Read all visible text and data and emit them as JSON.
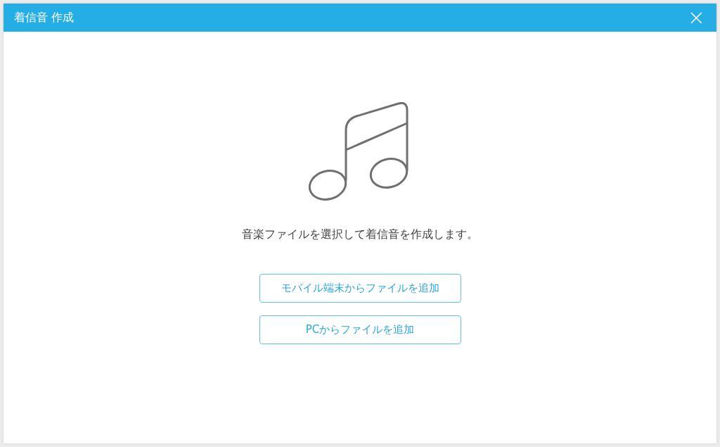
{
  "window": {
    "title": "着信音 作成",
    "close": "×"
  },
  "message": "音楽ファイルを選択して着信音を作成します。",
  "buttons": [
    "モバイル端末からファイルを追加",
    "PCからファイルを追加"
  ]
}
